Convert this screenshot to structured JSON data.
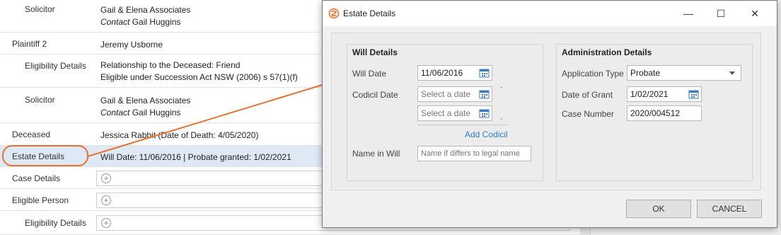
{
  "rows": {
    "solicitor1": {
      "label": "Solicitor",
      "firm": "Gail & Elena Associates",
      "contact_prefix": "Contact",
      "contact_name": "Gail Huggins"
    },
    "plaintiff2": {
      "label": "Plaintiff 2",
      "value": "Jeremy Usborne"
    },
    "eligibility1": {
      "label": "Eligibility Details",
      "line1": "Relationship to the Deceased: Friend",
      "line2": "Eligible under Succession Act NSW (2006) s 57(1)(f)"
    },
    "solicitor2": {
      "label": "Solicitor",
      "firm": "Gail & Elena Associates",
      "contact_prefix": "Contact",
      "contact_name": "Gail Huggins"
    },
    "deceased": {
      "label": "Deceased",
      "value": "Jessica Rabbit (Date of Death: 4/05/2020)"
    },
    "estate": {
      "label": "Estate Details",
      "value": "Will Date: 11/06/2016 | Probate granted: 1/02/2021"
    },
    "case": {
      "label": "Case Details"
    },
    "eligible_person": {
      "label": "Eligible Person"
    },
    "eligibility2": {
      "label": "Eligibility Details"
    }
  },
  "dialog": {
    "title": "Estate Details",
    "minimize": "—",
    "maximize": "☐",
    "close": "✕",
    "will": {
      "title": "Will Details",
      "will_date_label": "Will Date",
      "will_date_value": "11/06/2016",
      "codicil_label": "Codicil Date",
      "codicil_placeholder_1": "Select a date",
      "codicil_placeholder_2": "Select a date",
      "add_codicil": "Add Codicil",
      "name_label": "Name in Will",
      "name_placeholder": "Name if differs to legal name"
    },
    "admin": {
      "title": "Administration Details",
      "app_type_label": "Application Type",
      "app_type_value": "Probate",
      "grant_label": "Date of Grant",
      "grant_value": "1/02/2021",
      "case_label": "Case Number",
      "case_value": "2020/004512"
    },
    "ok": "OK",
    "cancel": "CANCEL"
  },
  "colors": {
    "accent": "#e8722b",
    "link": "#2f7fd0",
    "selected_row": "#dfe9f6"
  },
  "icons": [
    "app-logo-icon",
    "calendar-icon",
    "chevron-down-icon",
    "plus-circle-icon",
    "arrow-annotation"
  ]
}
